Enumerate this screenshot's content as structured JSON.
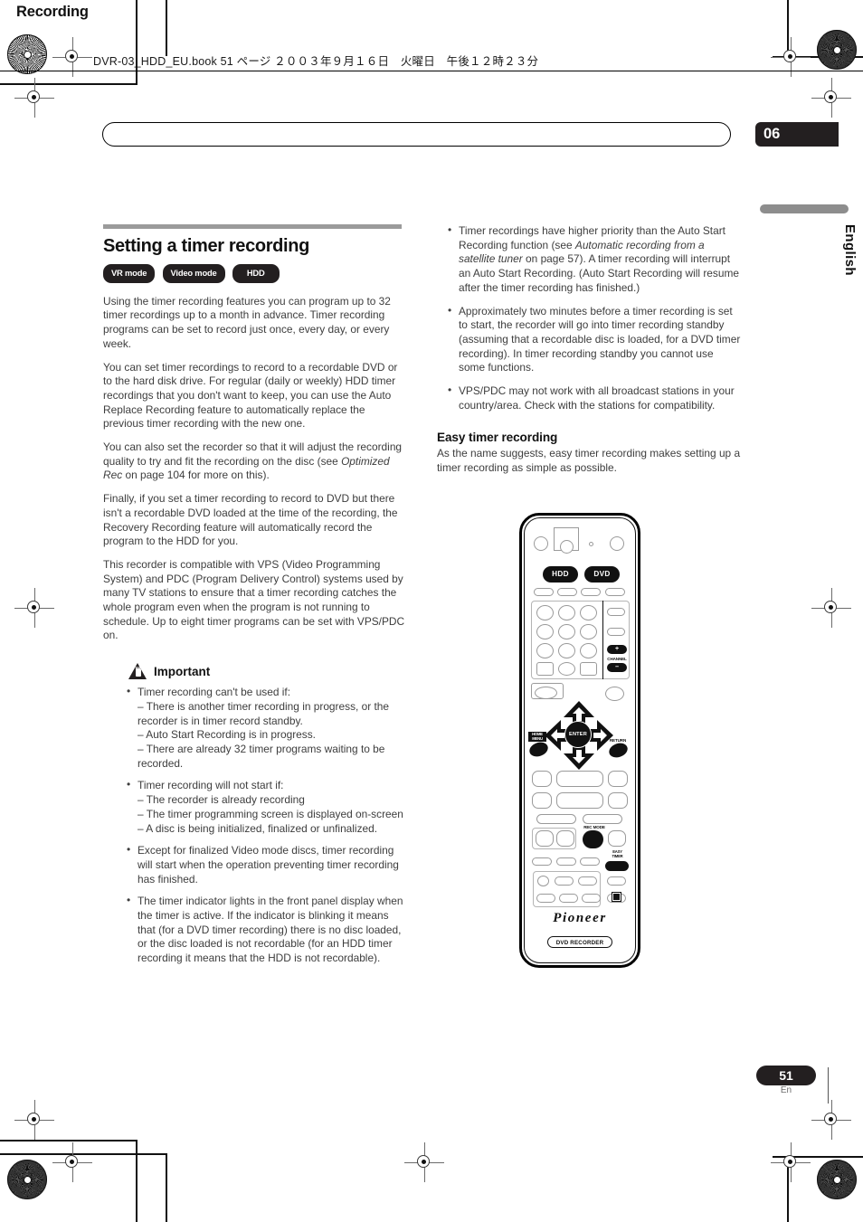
{
  "fileinfo": {
    "text": "DVR-03_HDD_EU.book 51 ページ ２００３年９月１６日　火曜日　午後１２時２３分"
  },
  "header": {
    "running_head": "Recording",
    "chapter_number": "06",
    "language_tab": "English"
  },
  "footer": {
    "page_number": "51",
    "page_lang": "En"
  },
  "left_column": {
    "section_title": "Setting a timer recording",
    "badges": [
      {
        "label": "VR mode"
      },
      {
        "label": "Video mode"
      },
      {
        "label": "HDD"
      }
    ],
    "paragraphs": [
      "Using the timer recording features you can program up to 32 timer recordings up to a month in advance. Timer recording programs can be set to record just once, every day, or every week.",
      "You can set timer recordings to record to a recordable DVD or to the hard disk drive. For regular (daily or weekly) HDD timer recordings that you don't want to keep, you can use the Auto Replace Recording feature to automatically replace the previous timer recording with the new one.",
      "Finally, if you set a timer recording to record to DVD but there isn't a recordable DVD loaded at the time of the recording, the Recovery Recording feature will automatically record the program to the HDD for you.",
      "This recorder is compatible with VPS (Video Programming System) and PDC (Program Delivery Control) systems used by many TV stations to ensure that a timer recording catches the whole program even when the program is not running to schedule. Up to eight timer programs can be set with VPS/PDC on."
    ],
    "optimized_paragraph": {
      "before": "You can also set the recorder so that it will adjust the recording quality to try and fit the recording on the disc (see ",
      "italic": "Optimized Rec",
      "after": " on page 104 for more on this)."
    },
    "important": {
      "label": "Important",
      "items": [
        {
          "lead": "Timer recording can't be used if:",
          "subs": [
            "– There is another timer recording in progress, or the recorder is in timer record standby.",
            "– Auto Start Recording is in progress.",
            "– There are already 32 timer programs waiting to be recorded."
          ]
        },
        {
          "lead": "Timer recording will not start if:",
          "subs": [
            "– The recorder is already recording",
            "– The timer programming screen is displayed on-screen",
            "– A disc is being initialized, finalized or unfinalized."
          ]
        },
        {
          "lead": "Except for finalized Video mode discs, timer recording will start when the operation preventing timer recording has finished.",
          "subs": []
        },
        {
          "lead": "The timer indicator lights in the front panel display when the timer is active. If the indicator is blinking it means that (for a DVD timer recording) there is no disc loaded, or the disc loaded is not recordable (for an HDD timer recording it means that the HDD is not recordable).",
          "subs": []
        }
      ]
    }
  },
  "right_column": {
    "bullets": [
      {
        "before": "Timer recordings have higher priority than the Auto Start Recording function (see ",
        "italic": "Automatic recording from a satellite tuner",
        "after": " on page 57). A timer recording will interrupt an Auto Start Recording. (Auto Start Recording will resume after the timer recording has finished.)"
      },
      {
        "before": "Approximately two minutes before a timer recording is set to start, the recorder will go into timer recording standby (assuming that a recordable disc is loaded, for a DVD timer recording). In timer recording standby you cannot use some functions.",
        "italic": "",
        "after": ""
      },
      {
        "before": "VPS/PDC may not work with all broadcast stations in your country/area. Check with the stations for compatibility.",
        "italic": "",
        "after": ""
      }
    ],
    "sub_title": "Easy timer recording",
    "sub_body": "As the name suggests, easy timer recording makes setting up a timer recording as simple as possible."
  },
  "remote": {
    "hdd_button": "HDD",
    "dvd_button": "DVD",
    "channel_label": "CHANNEL",
    "channel_plus": "+",
    "channel_minus": "–",
    "enter_button": "ENTER",
    "home_menu_label": "HOME MENU",
    "home_menu_line1": "HOME",
    "home_menu_line2": "MENU",
    "return_label": "RETURN",
    "rec_mode_label": "REC MODE",
    "easy_timer_line1": "EASY",
    "easy_timer_line2": "TIMER",
    "brand": "Pioneer",
    "product_label": "DVD RECORDER"
  }
}
